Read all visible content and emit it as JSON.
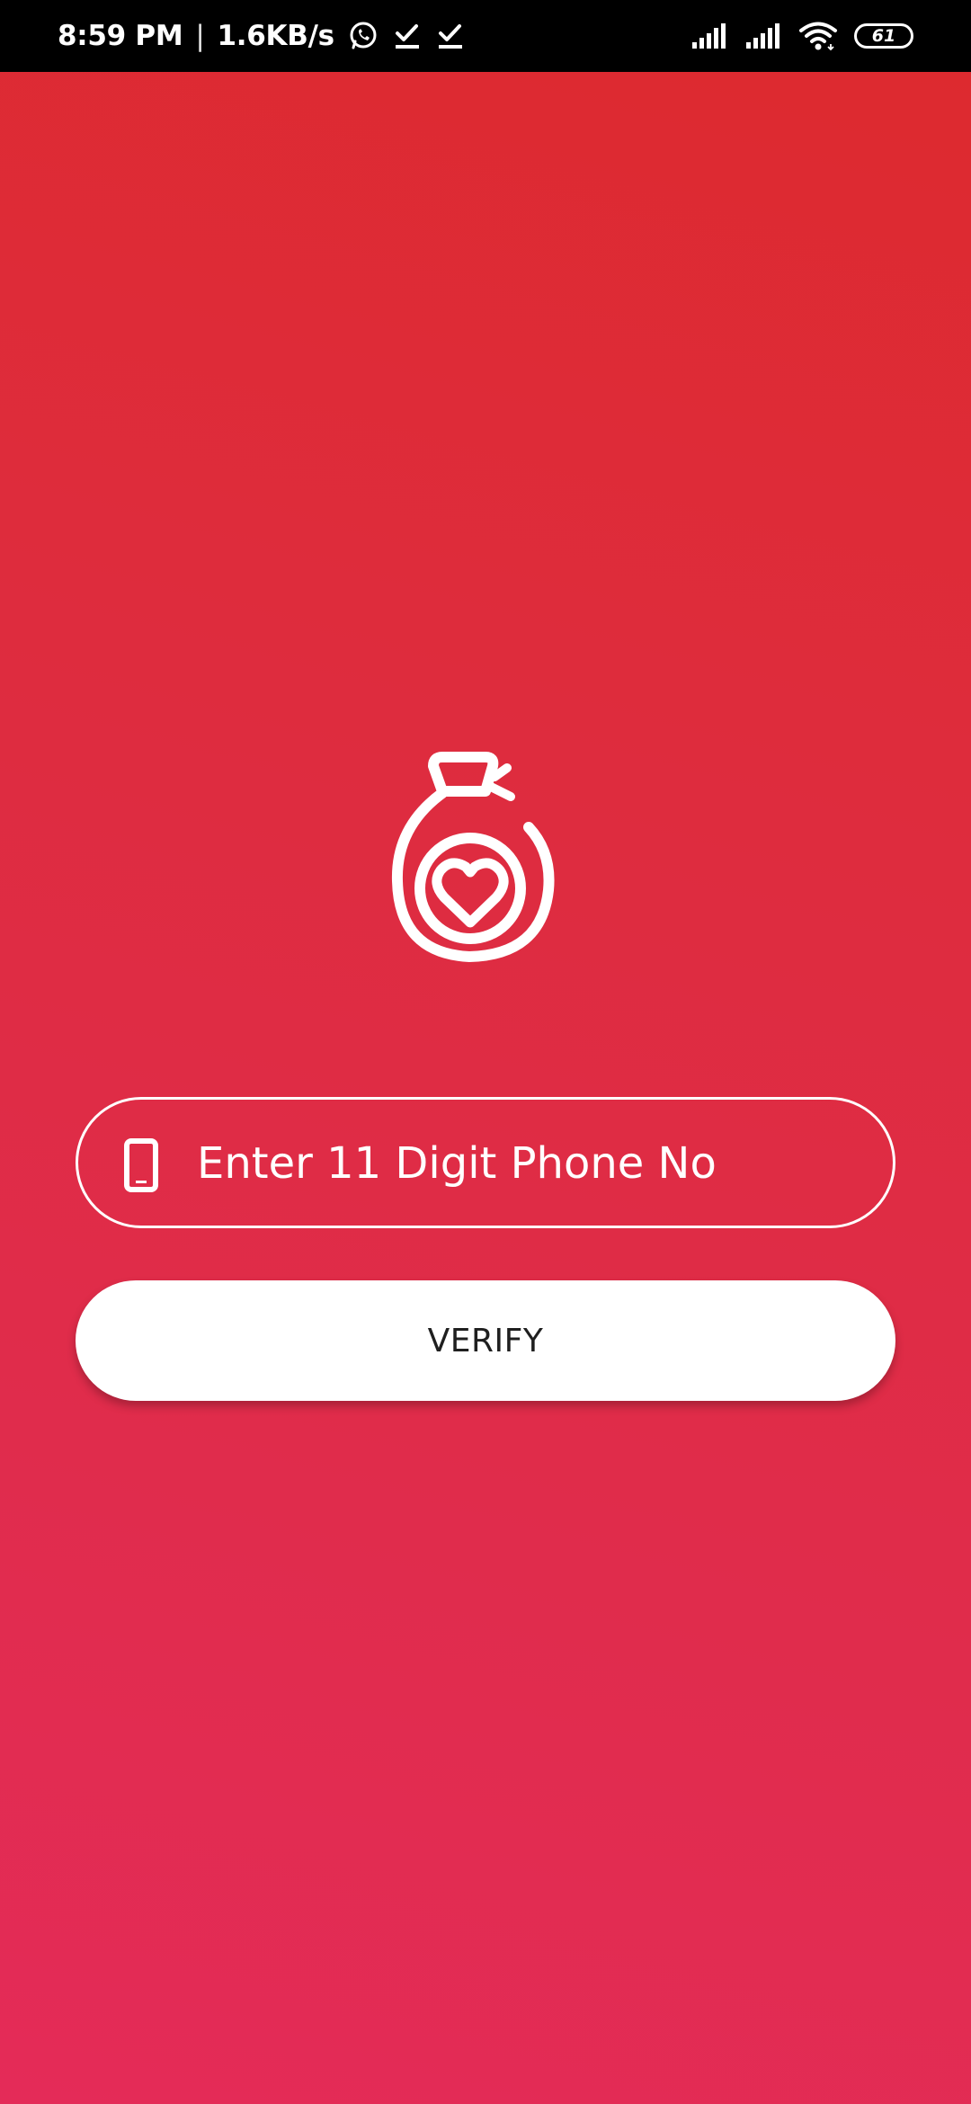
{
  "status_bar": {
    "time": "8:59 PM",
    "separator": "|",
    "network_speed": "1.6KB/s",
    "battery_level": "61",
    "icons": [
      "whatsapp-icon",
      "download-done-icon",
      "download-done-icon",
      "signal-icon",
      "signal-icon",
      "wifi-icon",
      "battery-icon"
    ]
  },
  "login": {
    "logo_icon": "money-bag-heart-icon",
    "phone_field_icon": "smartphone-icon",
    "phone_placeholder": "Enter 11 Digit Phone No",
    "phone_value": "",
    "verify_label": "VERIFY"
  },
  "colors": {
    "gradient_top": "#dd2a2f",
    "gradient_bottom": "#e42b58",
    "foreground": "#ffffff",
    "button_text": "#1f1f1f"
  }
}
